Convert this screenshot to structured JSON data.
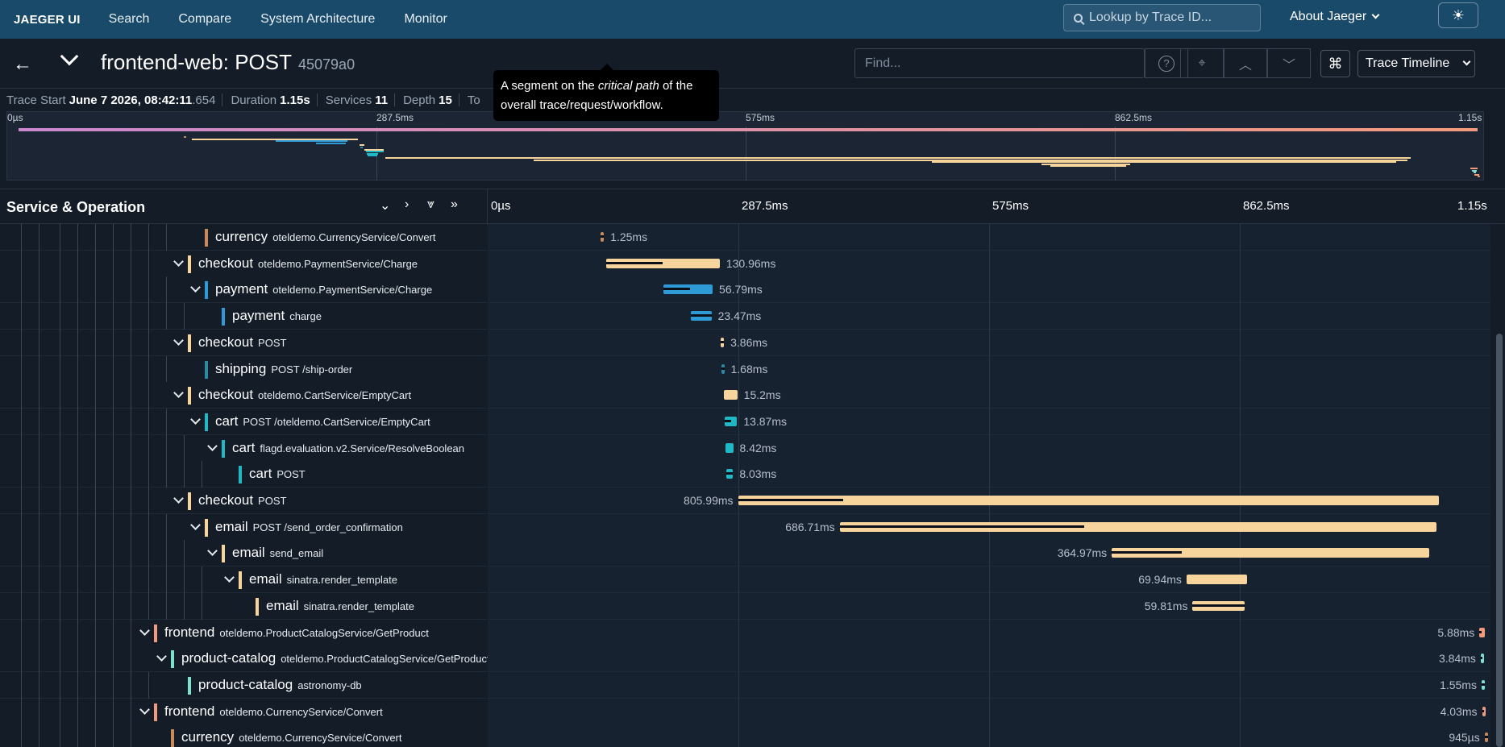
{
  "nav": {
    "brand": "JAEGER UI",
    "menu": [
      "Search",
      "Compare",
      "System Architecture",
      "Monitor"
    ],
    "lookup_placeholder": "Lookup by Trace ID...",
    "about": "About Jaeger",
    "theme_icon": "☀"
  },
  "header": {
    "back_icon": "←",
    "title": "frontend-web: POST",
    "trace_id": "45079a0",
    "find_placeholder": "Find...",
    "help_icon": "?",
    "locate_icon": "⌖",
    "prev_icon": "︿",
    "next_icon": "﹀",
    "kbd_icon": "⌘",
    "view_mode": "Trace Timeline"
  },
  "meta": {
    "trace_start_label": "Trace Start",
    "trace_start_value": "June 7 2026, 08:42:11",
    "trace_start_ms": ".654",
    "duration_label": "Duration",
    "duration_value": "1.15s",
    "services_label": "Services",
    "services_value": "11",
    "depth_label": "Depth",
    "depth_value": "15",
    "total_label": "To"
  },
  "tooltip": {
    "pre": "A segment on the ",
    "em": "critical path",
    "post": " of the overall trace/request/workflow."
  },
  "minimap": {
    "ticks": [
      "0µs",
      "287.5ms",
      "575ms",
      "862.5ms",
      "1.15s"
    ]
  },
  "columns": {
    "service_operation": "Service & Operation",
    "ticks": [
      "0µs",
      "287.5ms",
      "575ms",
      "862.5ms",
      "1.15s"
    ]
  },
  "colors": {
    "currency": "#c98b5b",
    "checkout": "#f7d49c",
    "payment": "#2e9bd6",
    "shipping": "#2a8aa0",
    "cart": "#1fb8c4",
    "email": "#f7d49c",
    "frontend": "#f49a7c",
    "product-catalog": "#7fe0d0"
  },
  "rows": [
    {
      "service": "currency",
      "op": "oteldemo.CurrencyService/Convert",
      "depth": 4,
      "toggle": false,
      "color": "currency",
      "duration": "1.25ms",
      "start_ms": 130.0,
      "dur_ms": 1.25,
      "cp_frac": 1.0,
      "label_left": false
    },
    {
      "service": "checkout",
      "op": "oteldemo.PaymentService/Charge",
      "depth": 3,
      "toggle": true,
      "color": "checkout",
      "duration": "130.96ms",
      "start_ms": 136.0,
      "dur_ms": 130.96,
      "cp_frac": 0.5,
      "label_left": false
    },
    {
      "service": "payment",
      "op": "oteldemo.PaymentService/Charge",
      "depth": 4,
      "toggle": true,
      "color": "payment",
      "duration": "56.79ms",
      "start_ms": 202.0,
      "dur_ms": 56.79,
      "cp_frac": 0.55,
      "label_left": false
    },
    {
      "service": "payment",
      "op": "charge",
      "depth": 5,
      "toggle": false,
      "color": "payment",
      "duration": "23.47ms",
      "start_ms": 234.0,
      "dur_ms": 23.47,
      "cp_frac": 1.0,
      "label_left": false
    },
    {
      "service": "checkout",
      "op": "POST",
      "depth": 3,
      "toggle": true,
      "color": "checkout",
      "duration": "3.86ms",
      "start_ms": 268.0,
      "dur_ms": 3.86,
      "cp_frac": 1.0,
      "label_left": false
    },
    {
      "service": "shipping",
      "op": "POST /ship-order",
      "depth": 4,
      "toggle": false,
      "color": "shipping",
      "duration": "1.68ms",
      "start_ms": 268.5,
      "dur_ms": 1.68,
      "cp_frac": 1.0,
      "label_left": false
    },
    {
      "service": "checkout",
      "op": "oteldemo.CartService/EmptyCart",
      "depth": 3,
      "toggle": true,
      "color": "checkout",
      "duration": "15.2ms",
      "start_ms": 272.0,
      "dur_ms": 15.2,
      "cp_frac": 0.0,
      "label_left": false
    },
    {
      "service": "cart",
      "op": "POST /oteldemo.CartService/EmptyCart",
      "depth": 4,
      "toggle": true,
      "color": "cart",
      "duration": "13.87ms",
      "start_ms": 273.0,
      "dur_ms": 13.87,
      "cp_frac": 0.5,
      "label_left": false
    },
    {
      "service": "cart",
      "op": "flagd.evaluation.v2.Service/ResolveBoolean",
      "depth": 5,
      "toggle": true,
      "color": "cart",
      "duration": "8.42ms",
      "start_ms": 274.0,
      "dur_ms": 8.42,
      "cp_frac": 0.0,
      "label_left": false
    },
    {
      "service": "cart",
      "op": "POST",
      "depth": 6,
      "toggle": false,
      "color": "cart",
      "duration": "8.03ms",
      "start_ms": 274.2,
      "dur_ms": 8.03,
      "cp_frac": 1.0,
      "label_left": false
    },
    {
      "service": "checkout",
      "op": "POST",
      "depth": 3,
      "toggle": true,
      "color": "checkout",
      "duration": "805.99ms",
      "start_ms": 288.0,
      "dur_ms": 805.99,
      "cp_frac": 0.15,
      "label_left": true
    },
    {
      "service": "email",
      "op": "POST /send_order_confirmation",
      "depth": 4,
      "toggle": true,
      "color": "email",
      "duration": "686.71ms",
      "start_ms": 405.0,
      "dur_ms": 686.71,
      "cp_frac": 0.41,
      "label_left": true
    },
    {
      "service": "email",
      "op": "send_email",
      "depth": 5,
      "toggle": true,
      "color": "email",
      "duration": "364.97ms",
      "start_ms": 718.0,
      "dur_ms": 364.97,
      "cp_frac": 0.22,
      "label_left": true
    },
    {
      "service": "email",
      "op": "sinatra.render_template",
      "depth": 6,
      "toggle": true,
      "color": "email",
      "duration": "69.94ms",
      "start_ms": 804.0,
      "dur_ms": 69.94,
      "cp_frac": 0.0,
      "label_left": true
    },
    {
      "service": "email",
      "op": "sinatra.render_template",
      "depth": 7,
      "toggle": false,
      "color": "email",
      "duration": "59.81ms",
      "start_ms": 811.0,
      "dur_ms": 59.81,
      "cp_frac": 1.0,
      "label_left": true
    },
    {
      "service": "frontend",
      "op": "oteldemo.ProductCatalogService/GetProduct",
      "depth": 1,
      "toggle": true,
      "color": "frontend",
      "duration": "5.88ms",
      "start_ms": 1141.0,
      "dur_ms": 5.88,
      "cp_frac": 0.5,
      "label_left": true
    },
    {
      "service": "product-catalog",
      "op": "oteldemo.ProductCatalogService/GetProduct",
      "depth": 2,
      "toggle": true,
      "color": "product-catalog",
      "duration": "3.84ms",
      "start_ms": 1142.5,
      "dur_ms": 3.84,
      "cp_frac": 0.5,
      "label_left": true
    },
    {
      "service": "product-catalog",
      "op": "astronomy-db",
      "depth": 3,
      "toggle": false,
      "color": "product-catalog",
      "duration": "1.55ms",
      "start_ms": 1143.5,
      "dur_ms": 1.55,
      "cp_frac": 1.0,
      "label_left": true
    },
    {
      "service": "frontend",
      "op": "oteldemo.CurrencyService/Convert",
      "depth": 1,
      "toggle": true,
      "color": "frontend",
      "duration": "4.03ms",
      "start_ms": 1144.0,
      "dur_ms": 4.03,
      "cp_frac": 0.5,
      "label_left": true
    },
    {
      "service": "currency",
      "op": "oteldemo.CurrencyService/Convert",
      "depth": 2,
      "toggle": false,
      "color": "currency",
      "duration": "945µs",
      "start_ms": 1147.0,
      "dur_ms": 0.945,
      "cp_frac": 1.0,
      "label_left": true
    }
  ]
}
